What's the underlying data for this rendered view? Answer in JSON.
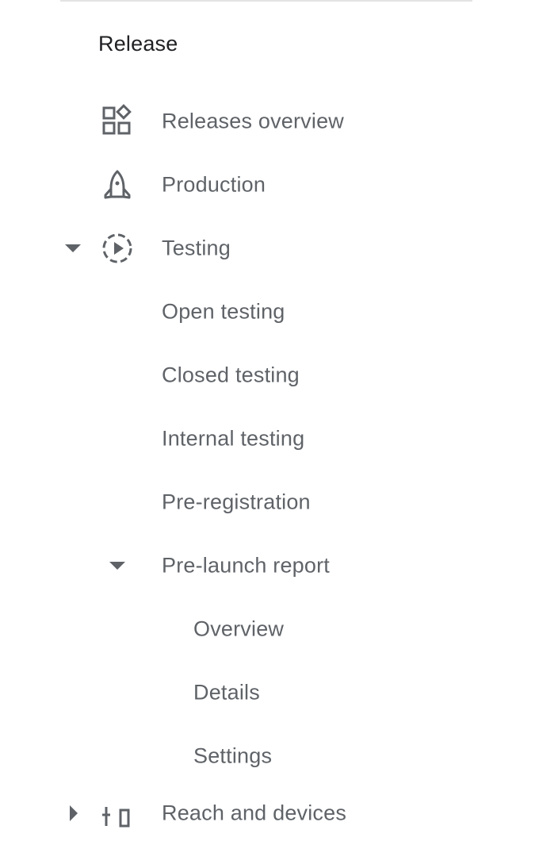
{
  "section": {
    "title": "Release"
  },
  "nav": {
    "releases_overview": {
      "label": "Releases overview",
      "icon": "dashboard-icon"
    },
    "production": {
      "label": "Production",
      "icon": "rocket-icon"
    },
    "testing": {
      "label": "Testing",
      "icon": "testing-play-icon",
      "expanded": true
    },
    "open_testing": {
      "label": "Open testing"
    },
    "closed_testing": {
      "label": "Closed testing"
    },
    "internal_testing": {
      "label": "Internal testing"
    },
    "pre_registration": {
      "label": "Pre-registration"
    },
    "pre_launch_report": {
      "label": "Pre-launch report",
      "expanded": true
    },
    "overview": {
      "label": "Overview"
    },
    "details": {
      "label": "Details"
    },
    "settings": {
      "label": "Settings"
    },
    "reach_and_devices": {
      "label": "Reach and devices",
      "icon": "bar-chart-icon",
      "expanded": false
    }
  },
  "colors": {
    "text_primary": "#202124",
    "text_secondary": "#5f6368",
    "divider": "#e3e3e3"
  }
}
